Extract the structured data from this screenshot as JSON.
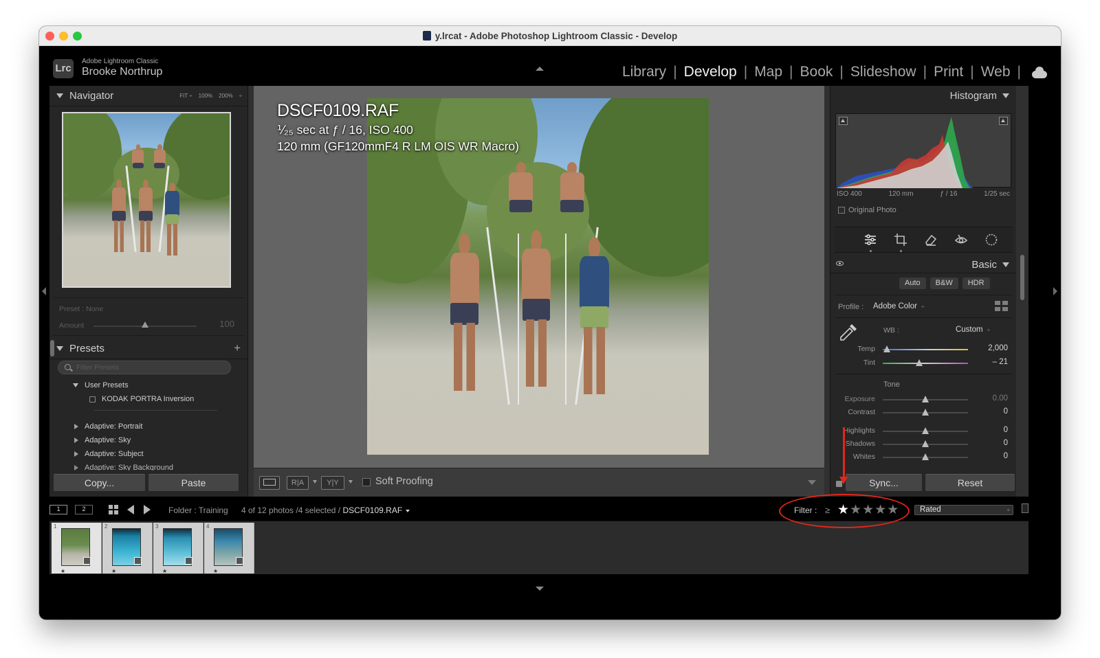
{
  "window": {
    "title": "y.lrcat - Adobe Photoshop Lightroom Classic - Develop"
  },
  "identity": {
    "logo": "Lrc",
    "app_name": "Adobe Lightroom Classic",
    "user_name": "Brooke Northrup"
  },
  "modules": [
    "Library",
    "Develop",
    "Map",
    "Book",
    "Slideshow",
    "Print",
    "Web"
  ],
  "active_module": "Develop",
  "navigator": {
    "title": "Navigator",
    "zoom_options": [
      "FIT ÷",
      "100%",
      "200%",
      "÷"
    ]
  },
  "preset_amount": {
    "preset_label": "Preset : None",
    "amount_label": "Amount",
    "amount_value": "100",
    "amount_fraction": 0.5
  },
  "presets": {
    "title": "Presets",
    "filter_placeholder": "Filter Presets",
    "user_group": "User Presets",
    "user_item": "KODAK PORTRA Inversion",
    "groups": [
      "Adaptive: Portrait",
      "Adaptive: Sky",
      "Adaptive: Subject",
      "Adaptive: Sky Background"
    ]
  },
  "left_footer": {
    "copy": "Copy...",
    "paste": "Paste"
  },
  "photo_info": {
    "filename": "DSCF0109.RAF",
    "exposure_line": "⅟₂₅ sec at ƒ / 16, ISO 400",
    "lens_line": "120 mm (GF120mmF4 R LM OIS WR Macro)"
  },
  "toolbar": {
    "view_loupe": "",
    "view_compare_ra": "R|A",
    "view_compare_yy": "Y|Y",
    "soft_proofing": "Soft Proofing"
  },
  "histogram": {
    "title": "Histogram",
    "iso": "ISO 400",
    "focal": "120 mm",
    "aperture": "ƒ / 16",
    "shutter": "1/25 sec",
    "original_photo": "Original Photo"
  },
  "tools": [
    "sliders-icon",
    "crop-icon",
    "healing-eraser-icon",
    "red-eye-icon",
    "masking-icon"
  ],
  "basic": {
    "title": "Basic",
    "treatments": [
      "Auto",
      "B&W",
      "HDR"
    ],
    "profile_label": "Profile :",
    "profile_value": "Adobe Color",
    "wb_label": "WB :",
    "wb_value": "Custom",
    "temp": {
      "label": "Temp",
      "value": "2,000",
      "fraction": 0.05
    },
    "tint": {
      "label": "Tint",
      "value": "– 21",
      "fraction": 0.43
    },
    "tone_label": "Tone",
    "exposure": {
      "label": "Exposure",
      "value": "0.00",
      "fraction": 0.5
    },
    "contrast": {
      "label": "Contrast",
      "value": "0",
      "fraction": 0.5
    },
    "highlights": {
      "label": "Highlights",
      "value": "0",
      "fraction": 0.5
    },
    "shadows": {
      "label": "Shadows",
      "value": "0",
      "fraction": 0.5
    },
    "whites": {
      "label": "Whites",
      "value": "0",
      "fraction": 0.5
    }
  },
  "right_footer": {
    "sync": "Sync...",
    "reset": "Reset"
  },
  "filmstrip_bar": {
    "screen1": "1",
    "screen2": "2",
    "folder": "Folder : Training",
    "count": "4 of 12 photos /4 selected /",
    "current_file": "DSCF0109.RAF",
    "filter_label": "Filter :",
    "filter_ge": "≥",
    "stars_total": 5,
    "stars_selected": 1,
    "rated": "Rated"
  },
  "thumbnails": [
    {
      "index": "1",
      "star": "★"
    },
    {
      "index": "2",
      "star": "★"
    },
    {
      "index": "3",
      "star": "★"
    },
    {
      "index": "4",
      "star": "★"
    }
  ],
  "colors": {
    "accent_annotation": "#e3261b",
    "panel_bg": "#262626",
    "center_bg": "#646464"
  }
}
